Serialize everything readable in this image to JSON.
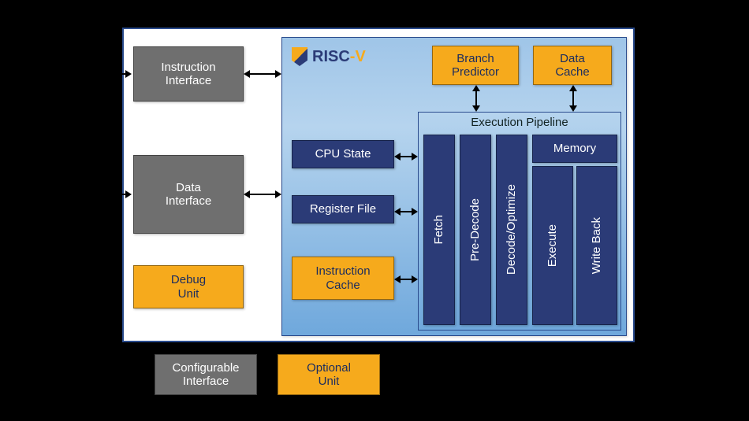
{
  "left_column": {
    "instruction_interface": "Instruction\nInterface",
    "data_interface": "Data\nInterface",
    "debug_unit": "Debug\nUnit"
  },
  "logo": {
    "text_main": "RISC",
    "text_dash": "-V"
  },
  "core": {
    "branch_predictor": "Branch\nPredictor",
    "data_cache": "Data\nCache",
    "cpu_state": "CPU State",
    "register_file": "Register File",
    "instruction_cache": "Instruction\nCache"
  },
  "pipeline": {
    "title": "Execution Pipeline",
    "fetch": "Fetch",
    "pre_decode": "Pre-Decode",
    "decode_optimize": "Decode/Optimize",
    "memory": "Memory",
    "execute": "Execute",
    "write_back": "Write Back"
  },
  "legend": {
    "configurable_interface": "Configurable\nInterface",
    "optional_unit": "Optional\nUnit"
  }
}
